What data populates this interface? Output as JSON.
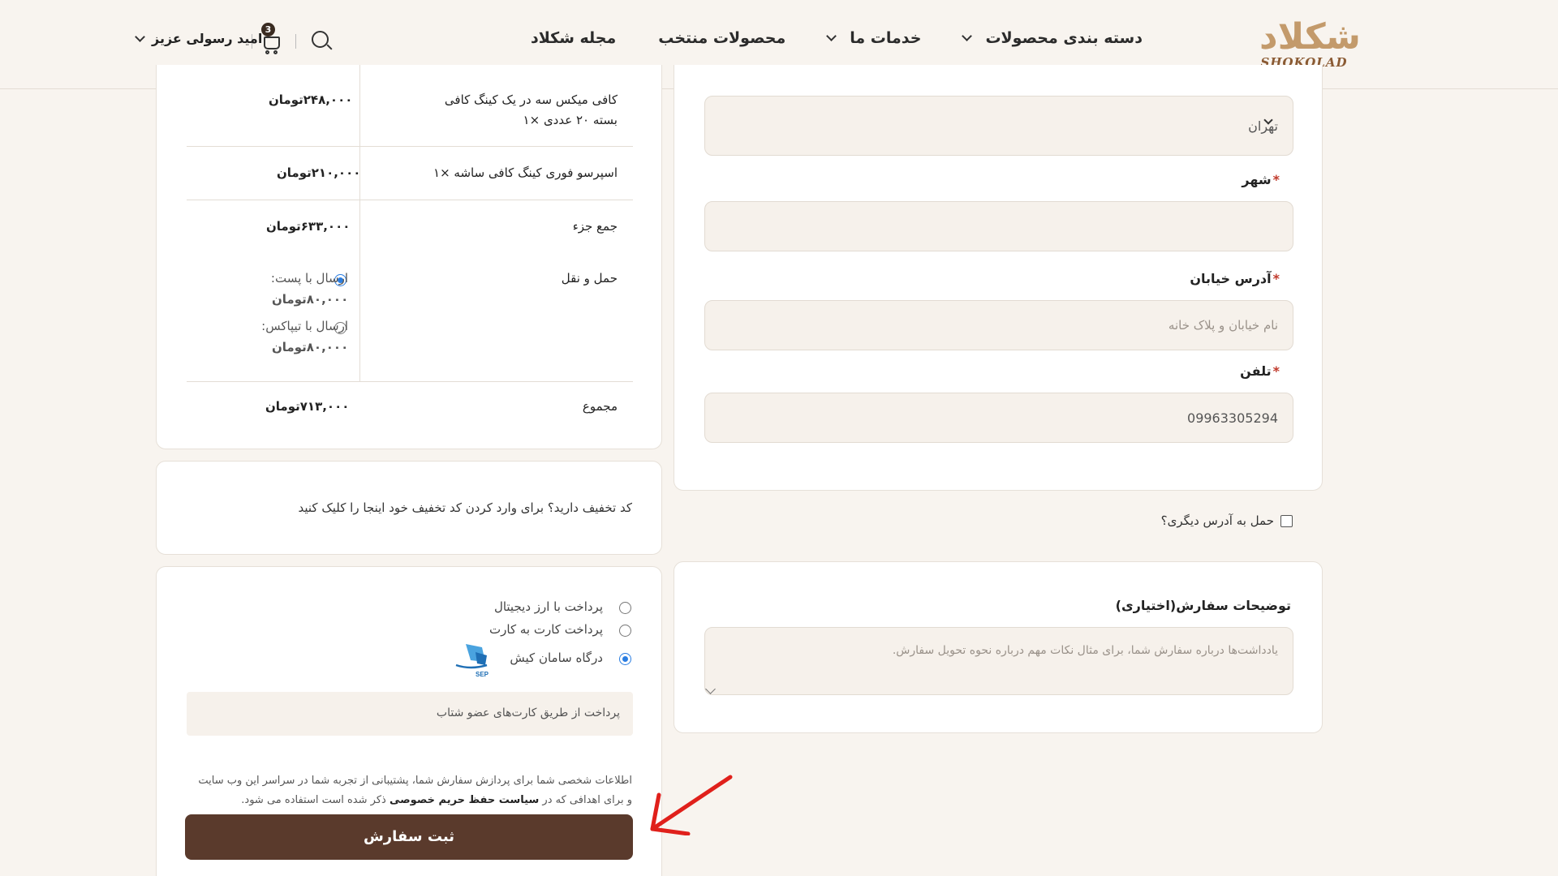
{
  "header": {
    "logo_fa": "شکلاد",
    "logo_en": "SHOKOLAD",
    "nav": [
      {
        "label": "دسته بندی محصولات",
        "has_dropdown": true
      },
      {
        "label": "خدمات ما",
        "has_dropdown": true
      },
      {
        "label": "محصولات منتخب",
        "has_dropdown": false
      },
      {
        "label": "مجله شکلاد",
        "has_dropdown": false
      }
    ],
    "cart_count": "3",
    "user_name": "امید رسولی عزیز"
  },
  "billing": {
    "province_value": "تهران",
    "city_label": "شهر",
    "street_label": "آدرس خیابان",
    "street_placeholder": "نام خیابان و پلاک خانه",
    "phone_label": "تلفن",
    "phone_value": "09963305294",
    "required_mark": "*"
  },
  "ship_other": {
    "label": "حمل به آدرس دیگری؟",
    "checked": false
  },
  "notes": {
    "label": "توضیحات سفارش(اختیاری)",
    "placeholder": "یادداشت‌ها درباره سفارش شما، برای مثال نکات مهم درباره نحوه تحویل سفارش."
  },
  "order": {
    "items": [
      {
        "name_line1": "کافی میکس سه در یک کینگ کافی",
        "name_line2": "بسته ۲۰ عددی ×۱",
        "price": "۲۴۸,۰۰۰تومان"
      },
      {
        "name_line1": "اسپرسو فوری کینگ کافی ساشه ×۱",
        "name_line2": "",
        "price": "۲۱۰,۰۰۰تومان"
      }
    ],
    "subtotal_label": "جمع جزء",
    "subtotal_value": "۶۳۳,۰۰۰تومان",
    "shipping_label": "حمل و نقل",
    "shipping_options": [
      {
        "label": "ارسال با پست:",
        "price": "۸۰,۰۰۰تومان",
        "selected": true
      },
      {
        "label": "ارسال با تیپاکس:",
        "price": "۸۰,۰۰۰تومان",
        "selected": false
      }
    ],
    "total_label": "مجموع",
    "total_value": "۷۱۳,۰۰۰تومان"
  },
  "coupon": {
    "text": "کد تخفیف دارید؟ برای وارد کردن کد تخفیف خود اینجا را کلیک کنید"
  },
  "payment": {
    "methods": [
      {
        "label": "پرداخت با ارز دیجیتال",
        "selected": false
      },
      {
        "label": "پرداخت کارت به کارت",
        "selected": false
      },
      {
        "label": "درگاه سامان کیش",
        "selected": true
      }
    ],
    "gateway_logo_text": "SEP",
    "gateway_description": "پرداخت از طریق کارت‌های عضو شتاب",
    "privacy_line1": "اطلاعات شخصی شما برای پردازش سفارش شما، پشتیبانی از تجربه شما در سراسر این وب سایت",
    "privacy_line2_pre": "و برای اهدافی که در",
    "privacy_link": "سیاست حفظ حریم خصوصی",
    "privacy_line2_post": "ذکر شده است استفاده می شود.",
    "submit_label": "ثبت سفارش"
  },
  "colors": {
    "background": "#f8f4ef",
    "brand_brown": "#5a3a2c",
    "logo_gold": "#c39a6b",
    "radio_blue": "#2a7de1",
    "arrow_red": "#e0201b"
  }
}
